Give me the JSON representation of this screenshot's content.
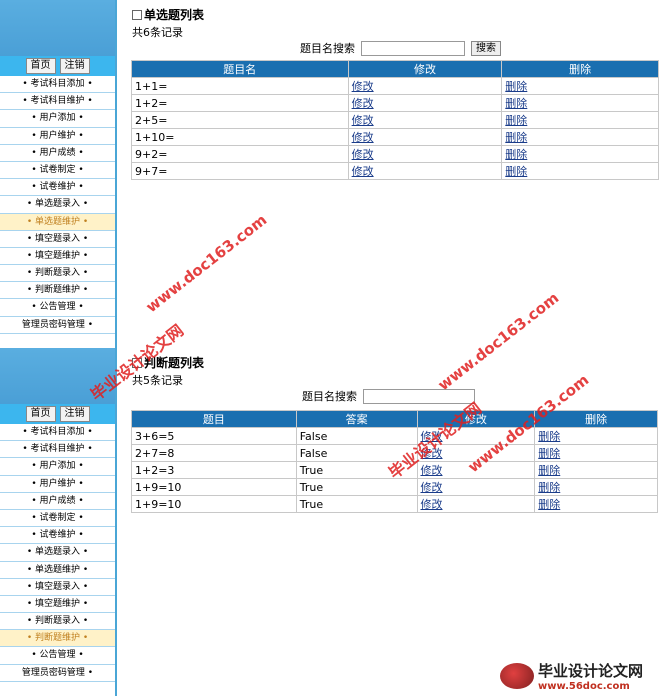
{
  "top": {
    "sidebar": {
      "home_label": "首页",
      "logout_label": "注销",
      "items": [
        "• 考试科目添加 •",
        "• 考试科目维护 •",
        "• 用户添加 •",
        "• 用户维护 •",
        "• 用户成绩 •",
        "• 试卷制定 •",
        "• 试卷维护 •",
        "• 单选题录入 •",
        "• 单选题维护 •",
        "• 填空题录入 •",
        "• 填空题维护 •",
        "• 判断题录入 •",
        "• 判断题维护 •",
        "• 公告管理 •",
        "管理员密码管理 •"
      ],
      "active_index": 8
    },
    "title": "单选题列表",
    "count": "共6条记录",
    "search_label": "题目名搜索",
    "search_value": "",
    "search_button": "搜索",
    "columns": [
      "题目名",
      "修改",
      "删除"
    ],
    "rows": [
      [
        "1+1=",
        "修改",
        "删除"
      ],
      [
        "1+2=",
        "修改",
        "删除"
      ],
      [
        "2+5=",
        "修改",
        "删除"
      ],
      [
        "1+10=",
        "修改",
        "删除"
      ],
      [
        "9+2=",
        "修改",
        "删除"
      ],
      [
        "9+7=",
        "修改",
        "删除"
      ]
    ]
  },
  "bottom": {
    "sidebar": {
      "home_label": "首页",
      "logout_label": "注销",
      "items": [
        "• 考试科目添加 •",
        "• 考试科目维护 •",
        "• 用户添加 •",
        "• 用户维护 •",
        "• 用户成绩 •",
        "• 试卷制定 •",
        "• 试卷维护 •",
        "• 单选题录入 •",
        "• 单选题维护 •",
        "• 填空题录入 •",
        "• 填空题维护 •",
        "• 判断题录入 •",
        "• 判断题维护 •",
        "• 公告管理 •",
        "管理员密码管理 •"
      ],
      "active_index": 12
    },
    "title": "判断题列表",
    "count": "共5条记录",
    "search_label": "题目名搜索",
    "search_value": "",
    "columns": [
      "题目",
      "答案",
      "修改",
      "删除"
    ],
    "rows": [
      [
        "3+6=5",
        "False",
        "修改",
        "删除"
      ],
      [
        "2+7=8",
        "False",
        "修改",
        "删除"
      ],
      [
        "1+2=3",
        "True",
        "修改",
        "删除"
      ],
      [
        "1+9=10",
        "True",
        "修改",
        "删除"
      ],
      [
        "1+9=10",
        "True",
        "修改",
        "删除"
      ]
    ]
  },
  "watermarks": [
    "www.doc163.com",
    "毕业设计论文网",
    "www.doc163.com",
    "毕业设计论文网",
    "www.doc163.com"
  ],
  "brand": {
    "name": "毕业设计论文网",
    "url": "www.56doc.com"
  },
  "colors": {
    "header_blue": "#1a6fb0",
    "sidebar_blue": "#4a9fd6",
    "watermark_red": "#e02020"
  }
}
